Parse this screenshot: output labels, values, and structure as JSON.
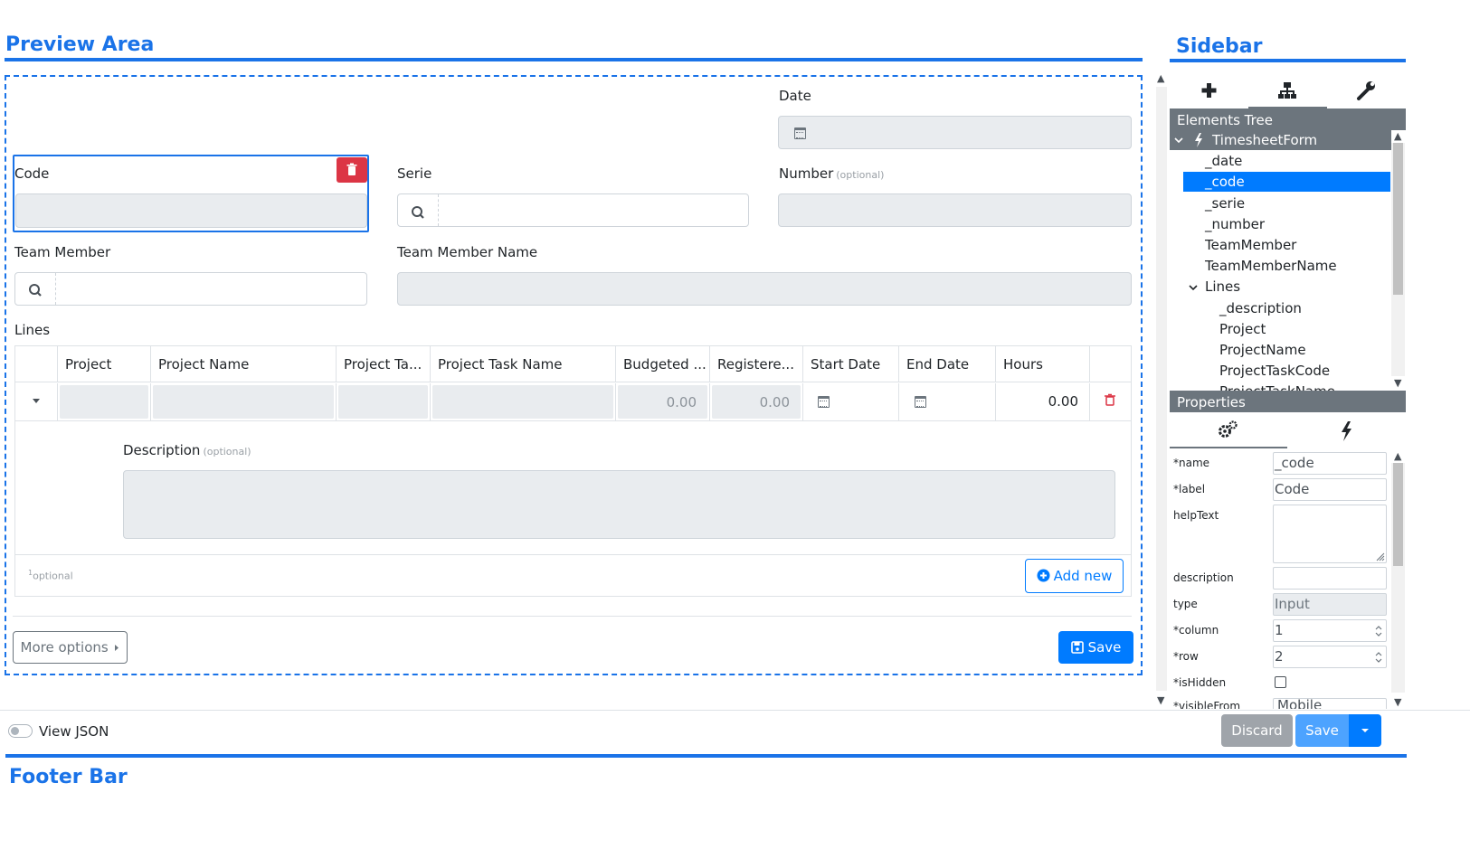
{
  "preview": {
    "title": "Preview Area",
    "fields": {
      "date_label": "Date",
      "code_label": "Code",
      "serie_label": "Serie",
      "number_label": "Number",
      "number_optional": "(optional)",
      "team_member_label": "Team Member",
      "team_member_name_label": "Team Member Name",
      "lines_label": "Lines"
    },
    "table": {
      "headers": [
        "Project",
        "Project Name",
        "Project Ta...",
        "Project Task Name",
        "Budgeted ...",
        "Registere...",
        "Start Date",
        "End Date",
        "Hours"
      ],
      "row": {
        "budgeted": "0.00",
        "registered": "0.00",
        "hours": "0.00"
      },
      "description_label": "Description",
      "description_optional": "(optional)",
      "footnote_sup": "1",
      "footnote_text": "optional",
      "add_new_label": "Add new"
    },
    "more_options_label": "More options",
    "save_label": "Save"
  },
  "sidebar": {
    "title": "Sidebar",
    "tabs": [
      "add-icon",
      "tree-icon",
      "wrench-icon"
    ],
    "elements_tree_header": "Elements Tree",
    "tree": {
      "root": "TimesheetForm",
      "items": [
        "_date",
        "_code",
        "_serie",
        "_number",
        "TeamMember",
        "TeamMemberName"
      ],
      "lines_group": "Lines",
      "lines_items": [
        "_description",
        "Project",
        "ProjectName",
        "ProjectTaskCode",
        "ProjectTaskName"
      ],
      "selected": "_code"
    },
    "properties_header": "Properties",
    "properties_tabs": [
      "gears-icon",
      "bolt-icon"
    ],
    "properties": {
      "name_label": "*name",
      "name_value": "_code",
      "label_label": "*label",
      "label_value": "Code",
      "helptext_label": "helpText",
      "description_label": "description",
      "type_label": "type",
      "type_value": "Input",
      "column_label": "*column",
      "column_value": "1",
      "row_label": "*row",
      "row_value": "2",
      "ishidden_label": "*isHidden",
      "visiblefrom_label": "*visibleFrom",
      "visiblefrom_value": "Mobile"
    }
  },
  "footer": {
    "view_json_label": "View JSON",
    "discard_label": "Discard",
    "save_label": "Save",
    "title": "Footer Bar"
  },
  "colors": {
    "accent": "#1a73e8",
    "primary": "#007bff",
    "danger": "#dc3545",
    "header_gray": "#6c757d"
  }
}
